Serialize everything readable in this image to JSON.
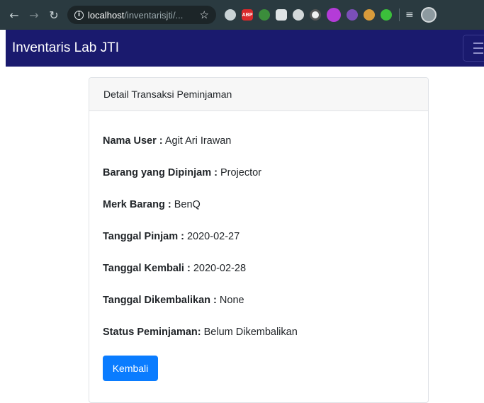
{
  "browser": {
    "url_host": "localhost",
    "url_path": "/inventarisjti/...",
    "extensions": [
      "globe-icon",
      "adblock-plus-icon",
      "leaf-icon",
      "chat-icon",
      "compass-icon",
      "ring-icon",
      "pink-extension-icon",
      "grape-icon",
      "cookie-icon",
      "green-dot-icon"
    ],
    "abp_label": "ABP"
  },
  "navbar": {
    "brand": "Inventaris Lab JTI"
  },
  "card": {
    "header": "Detail Transaksi Peminjaman",
    "fields": [
      {
        "label": "Nama User :",
        "value": " Agit Ari Irawan"
      },
      {
        "label": "Barang yang Dipinjam :",
        "value": " Projector"
      },
      {
        "label": "Merk Barang :",
        "value": " BenQ"
      },
      {
        "label": "Tanggal Pinjam :",
        "value": " 2020-02-27"
      },
      {
        "label": "Tanggal Kembali :",
        "value": " 2020-02-28"
      },
      {
        "label": "Tanggal Dikembalikan :",
        "value": " None"
      },
      {
        "label": "Status Peminjaman:",
        "value": " Belum Dikembalikan"
      }
    ],
    "back_button": "Kembali"
  },
  "colors": {
    "navbar_bg": "#1a1a6e",
    "button_bg": "#0a7cff",
    "chrome_bg": "#2a3a40"
  }
}
